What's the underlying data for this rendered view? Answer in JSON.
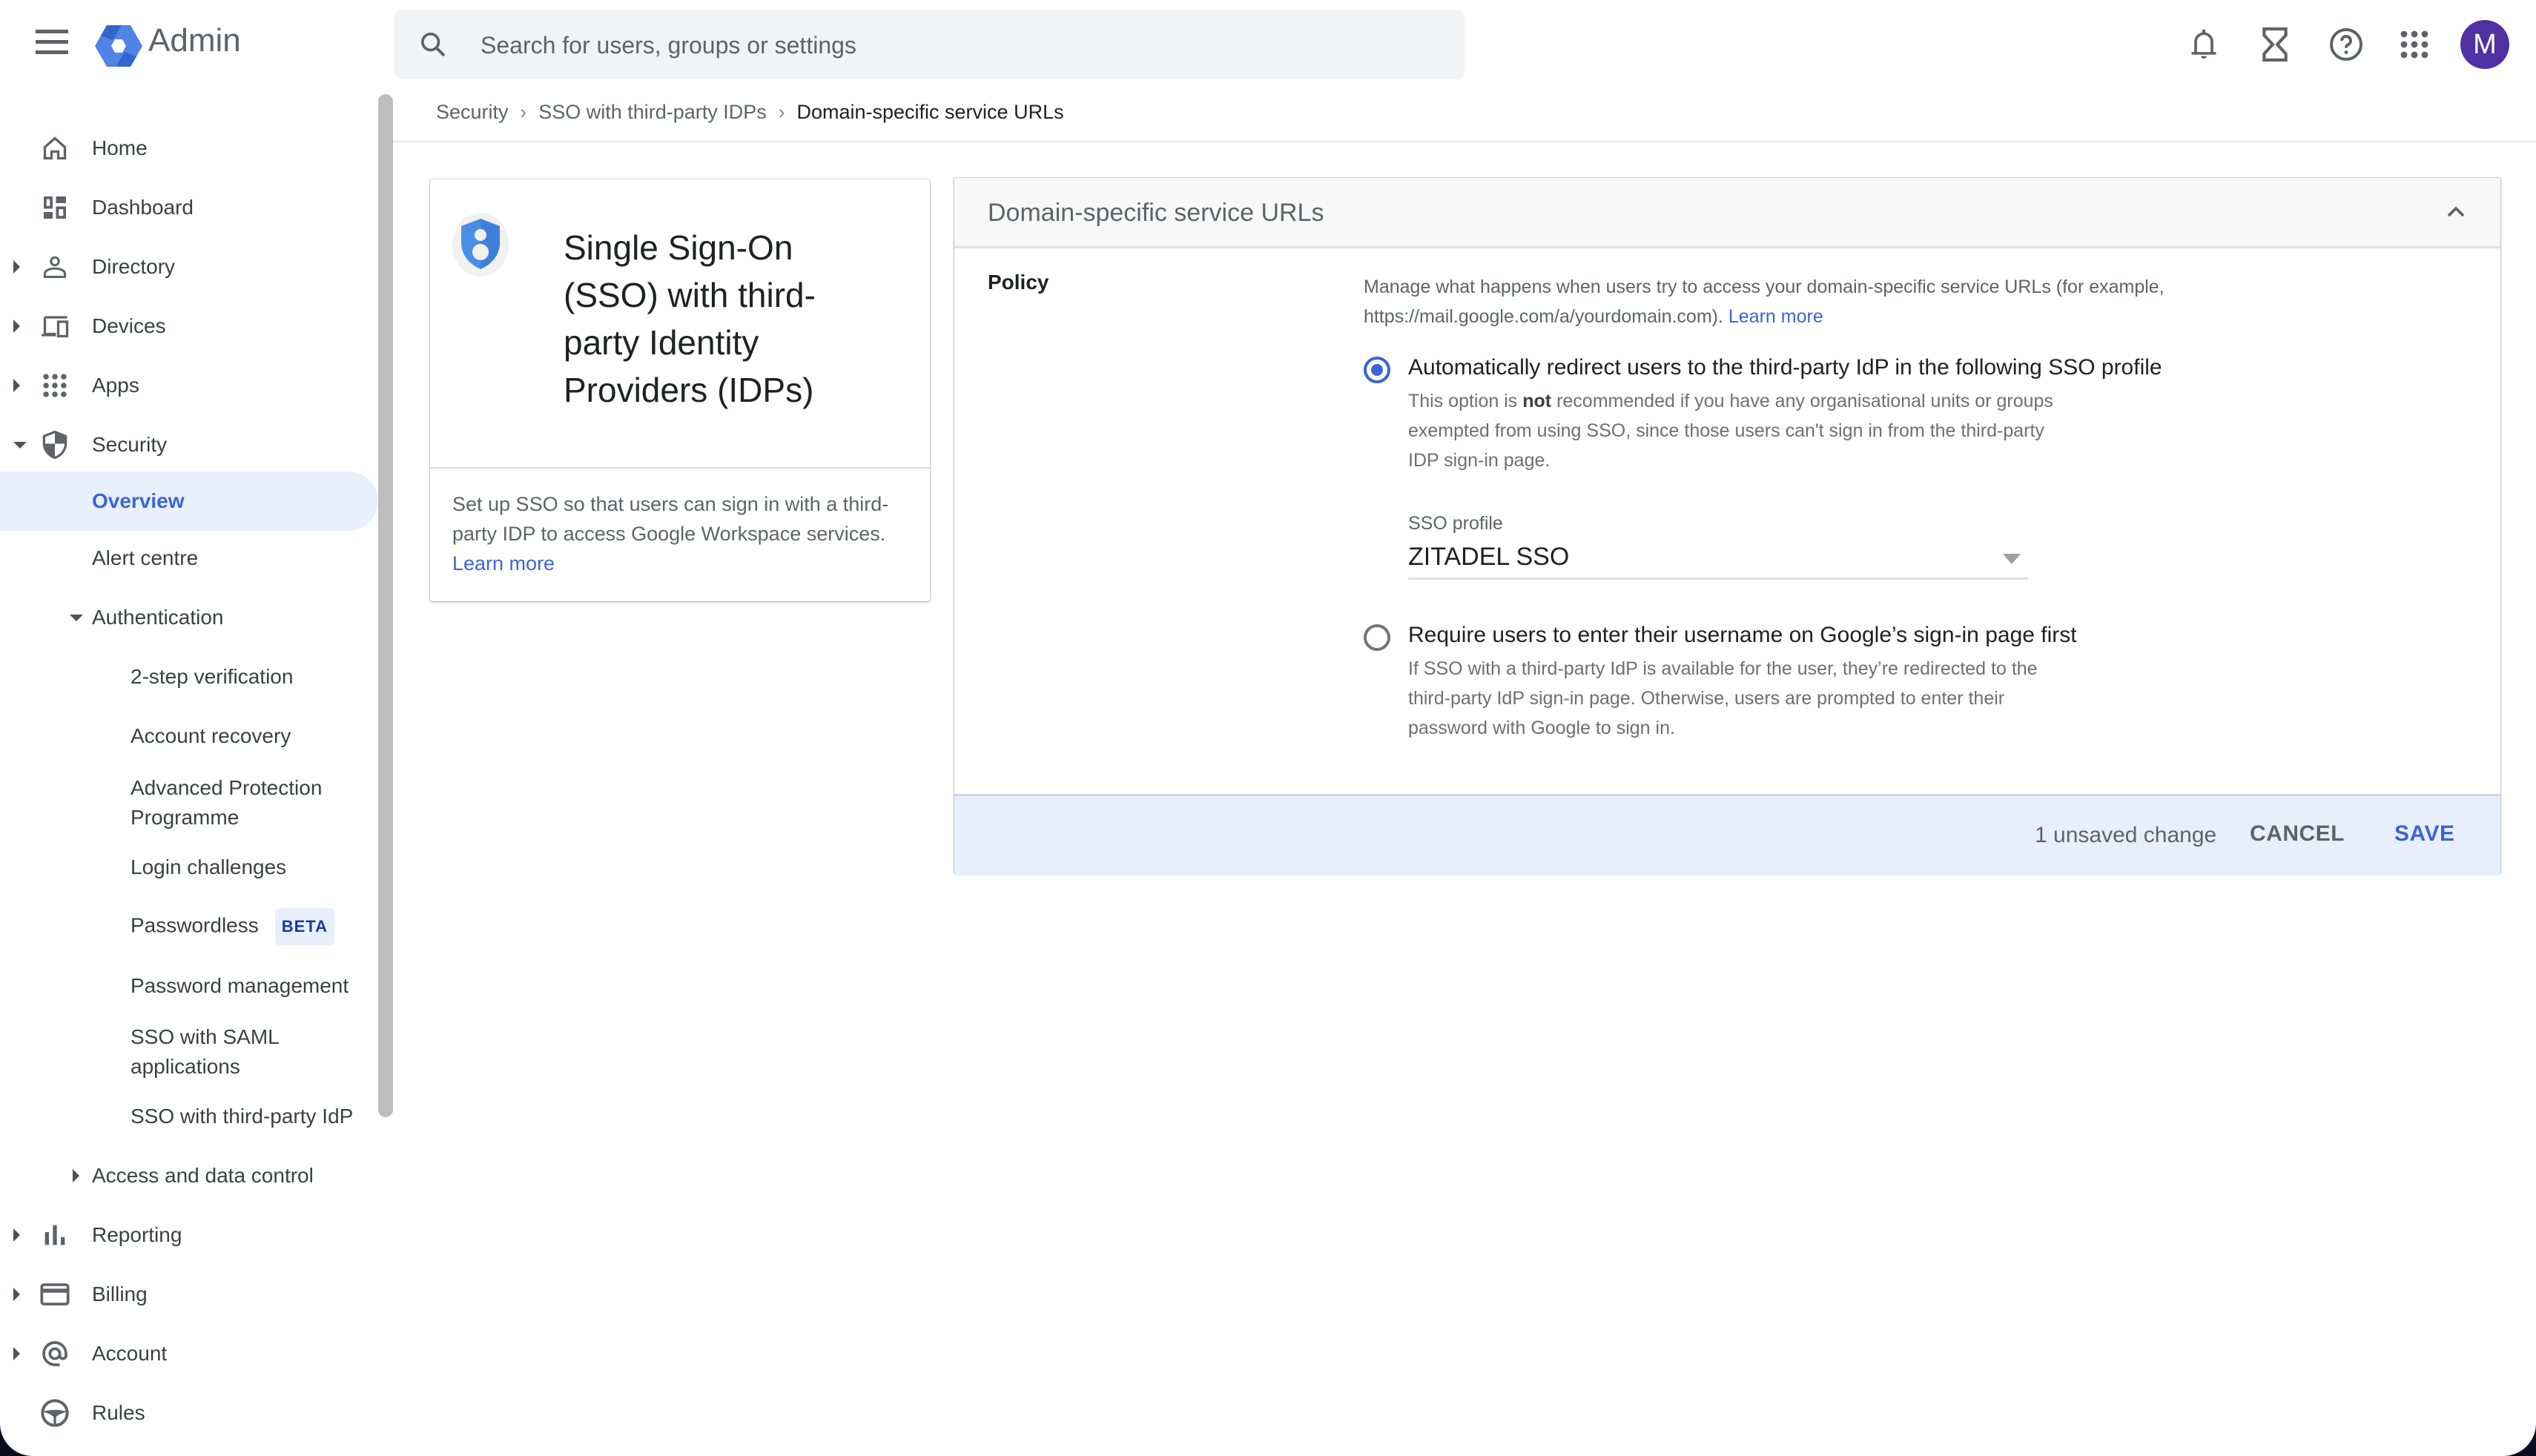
{
  "app": {
    "title": "Admin",
    "avatar_initial": "M",
    "colors": {
      "accent": "#3c64d6",
      "avatar": "#5130a3",
      "active_bg": "#e8f0fe",
      "footer_bg": "#e8effc"
    }
  },
  "search": {
    "placeholder": "Search for users, groups or settings",
    "value": ""
  },
  "topbar_icons": [
    "notifications-icon",
    "hourglass-icon",
    "help-icon",
    "apps-grid-icon"
  ],
  "sidebar": {
    "items": [
      {
        "label": "Home",
        "icon": "home-icon",
        "expandable": false
      },
      {
        "label": "Dashboard",
        "icon": "dashboard-icon",
        "expandable": false
      },
      {
        "label": "Directory",
        "icon": "person-icon",
        "expandable": true,
        "expanded": false
      },
      {
        "label": "Devices",
        "icon": "devices-icon",
        "expandable": true,
        "expanded": false
      },
      {
        "label": "Apps",
        "icon": "apps-icon",
        "expandable": true,
        "expanded": false
      },
      {
        "label": "Security",
        "icon": "shield-icon",
        "expandable": true,
        "expanded": true
      },
      {
        "label": "Overview",
        "active": true
      },
      {
        "label": "Alert centre"
      },
      {
        "label": "Authentication",
        "expandable": true,
        "expanded": true
      },
      {
        "label": "2-step verification"
      },
      {
        "label": "Account recovery"
      },
      {
        "label": "Advanced Protection Programme"
      },
      {
        "label": "Login challenges"
      },
      {
        "label": "Passwordless",
        "badge": "BETA"
      },
      {
        "label": "Password management"
      },
      {
        "label": "SSO with SAML applications"
      },
      {
        "label": "SSO with third-party IdP"
      },
      {
        "label": "Access and data control",
        "expandable": true,
        "expanded": false
      },
      {
        "label": "Reporting",
        "icon": "bar-chart-icon",
        "expandable": true,
        "expanded": false
      },
      {
        "label": "Billing",
        "icon": "credit-card-icon",
        "expandable": true,
        "expanded": false
      },
      {
        "label": "Account",
        "icon": "at-sign-icon",
        "expandable": true,
        "expanded": false
      },
      {
        "label": "Rules",
        "icon": "steering-wheel-icon",
        "expandable": false
      }
    ]
  },
  "breadcrumb": {
    "items": [
      "Security",
      "SSO with third-party IDPs"
    ],
    "current": "Domain-specific service URLs"
  },
  "info_card": {
    "title": "Single Sign-On (SSO) with third-party Identity Providers (IDPs)",
    "description": "Set up SSO so that users can sign in with a third-party IDP to access Google Workspace services.",
    "link": "Learn more"
  },
  "panel": {
    "title": "Domain-specific service URLs",
    "policy_label": "Policy",
    "policy_description": "Manage what happens when users try to access your domain-specific service URLs (for example, https://mail.google.com/a/yourdomain.com).",
    "policy_link": "Learn more",
    "options": [
      {
        "label": "Automatically redirect users to the third-party IdP in the following SSO profile",
        "help_before": "This option is ",
        "help_bold": "not",
        "help_after": " recommended if you have any organisational units or groups exempted from using SSO, since those users can't sign in from the third-party IDP sign-in page.",
        "checked": true
      },
      {
        "label": "Require users to enter their username on Google’s sign-in page first",
        "help": "If SSO with a third-party IdP is available for the user, they’re redirected to the third-party IdP sign-in page. Otherwise, users are prompted to enter their password with Google to sign in.",
        "checked": false
      }
    ],
    "sso_profile": {
      "label": "SSO profile",
      "value": "ZITADEL SSO"
    },
    "footer": {
      "unsaved": "1 unsaved change",
      "cancel": "CANCEL",
      "save": "SAVE"
    }
  }
}
